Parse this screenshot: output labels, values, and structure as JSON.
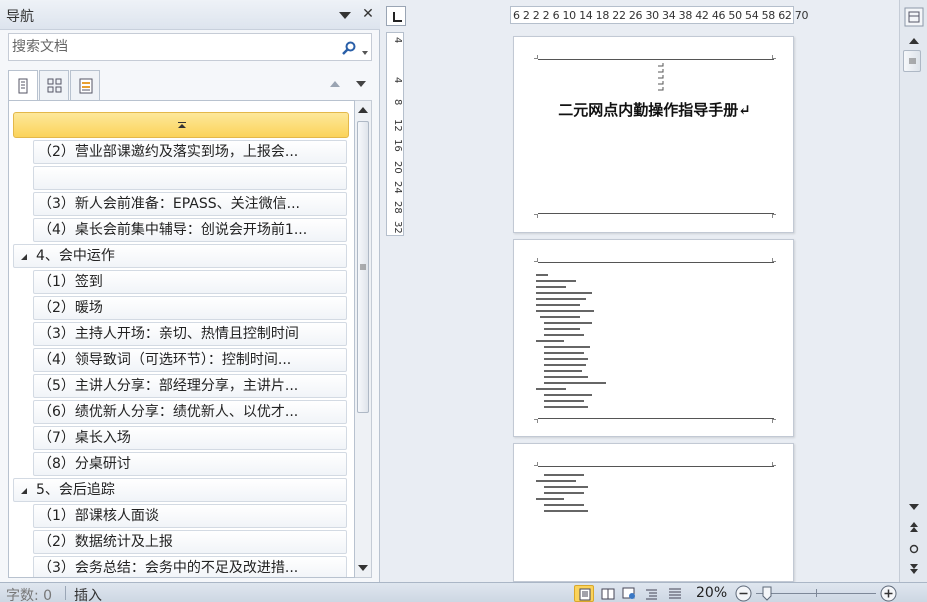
{
  "nav": {
    "title": "导航",
    "search_placeholder": "搜索文档",
    "tree": [
      {
        "level": 2,
        "text": "（2）营业部课邀约及落实到场，上报会..."
      },
      {
        "level": 2,
        "text": ""
      },
      {
        "level": 2,
        "text": "（3）新人会前准备：EPASS、关注微信..."
      },
      {
        "level": 2,
        "text": "（4）桌长会前集中辅导：创说会开场前1..."
      },
      {
        "level": 1,
        "text": "4、会中运作"
      },
      {
        "level": 2,
        "text": "（1）签到"
      },
      {
        "level": 2,
        "text": "（2）暖场"
      },
      {
        "level": 2,
        "text": "（3）主持人开场：亲切、热情且控制时间"
      },
      {
        "level": 2,
        "text": "（4）领导致词（可选环节）：控制时间..."
      },
      {
        "level": 2,
        "text": "（5）主讲人分享：部经理分享，主讲片..."
      },
      {
        "level": 2,
        "text": "（6）绩优新人分享：绩优新人、以优才..."
      },
      {
        "level": 2,
        "text": "（7）桌长入场"
      },
      {
        "level": 2,
        "text": "（8）分桌研讨"
      },
      {
        "level": 1,
        "text": "5、会后追踪"
      },
      {
        "level": 2,
        "text": "（1）部课核人面谈"
      },
      {
        "level": 2,
        "text": "（2）数据统计及上报"
      },
      {
        "level": 2,
        "text": "（3）会务总结：会务中的不足及改进措..."
      }
    ]
  },
  "ruler": {
    "horizontal": "6 2 2 2 6 10 14 18 22 26 30 34 38 42 46 50 54 58 62 70",
    "vertical": [
      "4",
      "4",
      "8",
      "12",
      "16",
      "20",
      "24",
      "28",
      "32"
    ]
  },
  "document": {
    "title": "二元网点内勤操作指导手册↵"
  },
  "status": {
    "word_count": "字数: 0",
    "mode": "插入",
    "zoom": "20%"
  },
  "colors": {
    "accent": "#fbd35a",
    "pane_bg": "#f5f7fa",
    "workspace_bg": "#e9edf3"
  }
}
